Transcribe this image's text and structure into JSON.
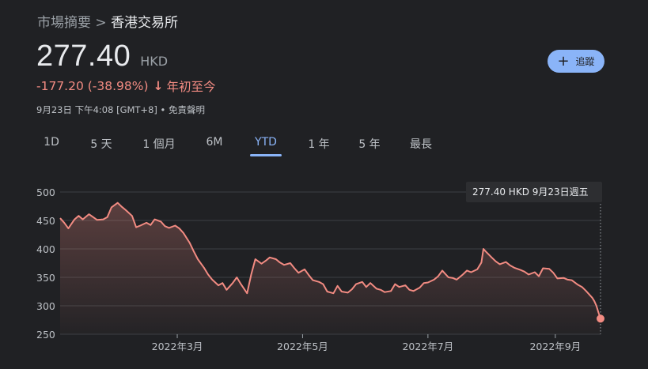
{
  "breadcrumb": {
    "root": "市場摘要",
    "separator": ">",
    "current": "香港交易所"
  },
  "quote": {
    "price": "277.40",
    "currency": "HKD",
    "change": "-177.20 (-38.98%)",
    "change_arrow": "↓",
    "change_period": "年初至今",
    "timestamp": "9月23日 下午4:08 [GMT+8] • 免責聲明"
  },
  "follow_button": {
    "label": "追蹤",
    "icon": "plus-icon"
  },
  "tabs": [
    {
      "label": "1D",
      "active": false
    },
    {
      "label": "5 天",
      "active": false
    },
    {
      "label": "1 個月",
      "active": false
    },
    {
      "label": "6M",
      "active": false
    },
    {
      "label": "YTD",
      "active": true
    },
    {
      "label": "1 年",
      "active": false
    },
    {
      "label": "5 年",
      "active": false
    },
    {
      "label": "最長",
      "active": false
    }
  ],
  "tooltip": {
    "text": "277.40 HKD  9月23日週五"
  },
  "colors": {
    "line": "#f28b82",
    "accent": "#8ab4f8",
    "background": "#202124"
  },
  "chart_data": {
    "type": "area",
    "x_start": "2022-01-03",
    "x_end": "2022-09-23",
    "ylim": [
      250,
      500
    ],
    "yticks": [
      250,
      300,
      350,
      400,
      450,
      500
    ],
    "x_ticks": [
      {
        "label": "2022年3月",
        "date": "2022-03-01"
      },
      {
        "label": "2022年5月",
        "date": "2022-05-01"
      },
      {
        "label": "2022年7月",
        "date": "2022-07-01"
      },
      {
        "label": "2022年9月",
        "date": "2022-09-01"
      }
    ],
    "grid": true,
    "series": [
      {
        "points": [
          [
            "2022-01-03",
            454
          ],
          [
            "2022-01-05",
            446
          ],
          [
            "2022-01-07",
            436
          ],
          [
            "2022-01-10",
            452
          ],
          [
            "2022-01-12",
            458
          ],
          [
            "2022-01-14",
            452
          ],
          [
            "2022-01-17",
            461
          ],
          [
            "2022-01-19",
            456
          ],
          [
            "2022-01-21",
            451
          ],
          [
            "2022-01-24",
            452
          ],
          [
            "2022-01-26",
            456
          ],
          [
            "2022-01-28",
            473
          ],
          [
            "2022-01-31",
            481
          ],
          [
            "2022-02-02",
            474
          ],
          [
            "2022-02-04",
            468
          ],
          [
            "2022-02-07",
            458
          ],
          [
            "2022-02-09",
            438
          ],
          [
            "2022-02-11",
            441
          ],
          [
            "2022-02-14",
            446
          ],
          [
            "2022-02-16",
            442
          ],
          [
            "2022-02-18",
            452
          ],
          [
            "2022-02-21",
            448
          ],
          [
            "2022-02-23",
            440
          ],
          [
            "2022-02-25",
            437
          ],
          [
            "2022-02-28",
            441
          ],
          [
            "2022-03-02",
            436
          ],
          [
            "2022-03-04",
            428
          ],
          [
            "2022-03-07",
            411
          ],
          [
            "2022-03-09",
            396
          ],
          [
            "2022-03-11",
            382
          ],
          [
            "2022-03-14",
            367
          ],
          [
            "2022-03-16",
            355
          ],
          [
            "2022-03-18",
            346
          ],
          [
            "2022-03-21",
            336
          ],
          [
            "2022-03-23",
            340
          ],
          [
            "2022-03-25",
            328
          ],
          [
            "2022-03-28",
            340
          ],
          [
            "2022-03-30",
            350
          ],
          [
            "2022-04-01",
            338
          ],
          [
            "2022-04-04",
            322
          ],
          [
            "2022-04-06",
            355
          ],
          [
            "2022-04-08",
            382
          ],
          [
            "2022-04-11",
            374
          ],
          [
            "2022-04-13",
            379
          ],
          [
            "2022-04-15",
            385
          ],
          [
            "2022-04-18",
            382
          ],
          [
            "2022-04-20",
            376
          ],
          [
            "2022-04-22",
            372
          ],
          [
            "2022-04-25",
            375
          ],
          [
            "2022-04-27",
            366
          ],
          [
            "2022-04-29",
            358
          ],
          [
            "2022-05-02",
            364
          ],
          [
            "2022-05-04",
            354
          ],
          [
            "2022-05-06",
            345
          ],
          [
            "2022-05-09",
            342
          ],
          [
            "2022-05-11",
            338
          ],
          [
            "2022-05-13",
            325
          ],
          [
            "2022-05-16",
            322
          ],
          [
            "2022-05-18",
            335
          ],
          [
            "2022-05-20",
            325
          ],
          [
            "2022-05-23",
            323
          ],
          [
            "2022-05-25",
            329
          ],
          [
            "2022-05-27",
            338
          ],
          [
            "2022-05-30",
            342
          ],
          [
            "2022-06-01",
            333
          ],
          [
            "2022-06-03",
            340
          ],
          [
            "2022-06-06",
            330
          ],
          [
            "2022-06-08",
            328
          ],
          [
            "2022-06-10",
            324
          ],
          [
            "2022-06-13",
            326
          ],
          [
            "2022-06-15",
            338
          ],
          [
            "2022-06-17",
            333
          ],
          [
            "2022-06-20",
            336
          ],
          [
            "2022-06-22",
            328
          ],
          [
            "2022-06-24",
            326
          ],
          [
            "2022-06-27",
            332
          ],
          [
            "2022-06-29",
            340
          ],
          [
            "2022-07-01",
            341
          ],
          [
            "2022-07-04",
            346
          ],
          [
            "2022-07-06",
            352
          ],
          [
            "2022-07-08",
            362
          ],
          [
            "2022-07-11",
            350
          ],
          [
            "2022-07-13",
            349
          ],
          [
            "2022-07-15",
            346
          ],
          [
            "2022-07-18",
            355
          ],
          [
            "2022-07-20",
            362
          ],
          [
            "2022-07-22",
            359
          ],
          [
            "2022-07-25",
            364
          ],
          [
            "2022-07-27",
            376
          ],
          [
            "2022-07-28",
            400
          ],
          [
            "2022-07-29",
            396
          ],
          [
            "2022-08-01",
            385
          ],
          [
            "2022-08-03",
            378
          ],
          [
            "2022-08-05",
            373
          ],
          [
            "2022-08-08",
            377
          ],
          [
            "2022-08-10",
            371
          ],
          [
            "2022-08-12",
            367
          ],
          [
            "2022-08-15",
            363
          ],
          [
            "2022-08-17",
            360
          ],
          [
            "2022-08-19",
            355
          ],
          [
            "2022-08-22",
            359
          ],
          [
            "2022-08-24",
            352
          ],
          [
            "2022-08-26",
            366
          ],
          [
            "2022-08-29",
            365
          ],
          [
            "2022-08-31",
            358
          ],
          [
            "2022-09-02",
            348
          ],
          [
            "2022-09-05",
            349
          ],
          [
            "2022-09-07",
            346
          ],
          [
            "2022-09-09",
            345
          ],
          [
            "2022-09-12",
            337
          ],
          [
            "2022-09-14",
            333
          ],
          [
            "2022-09-16",
            326
          ],
          [
            "2022-09-19",
            314
          ],
          [
            "2022-09-20",
            308
          ],
          [
            "2022-09-21",
            300
          ],
          [
            "2022-09-22",
            288
          ],
          [
            "2022-09-23",
            277.4
          ]
        ]
      }
    ]
  }
}
